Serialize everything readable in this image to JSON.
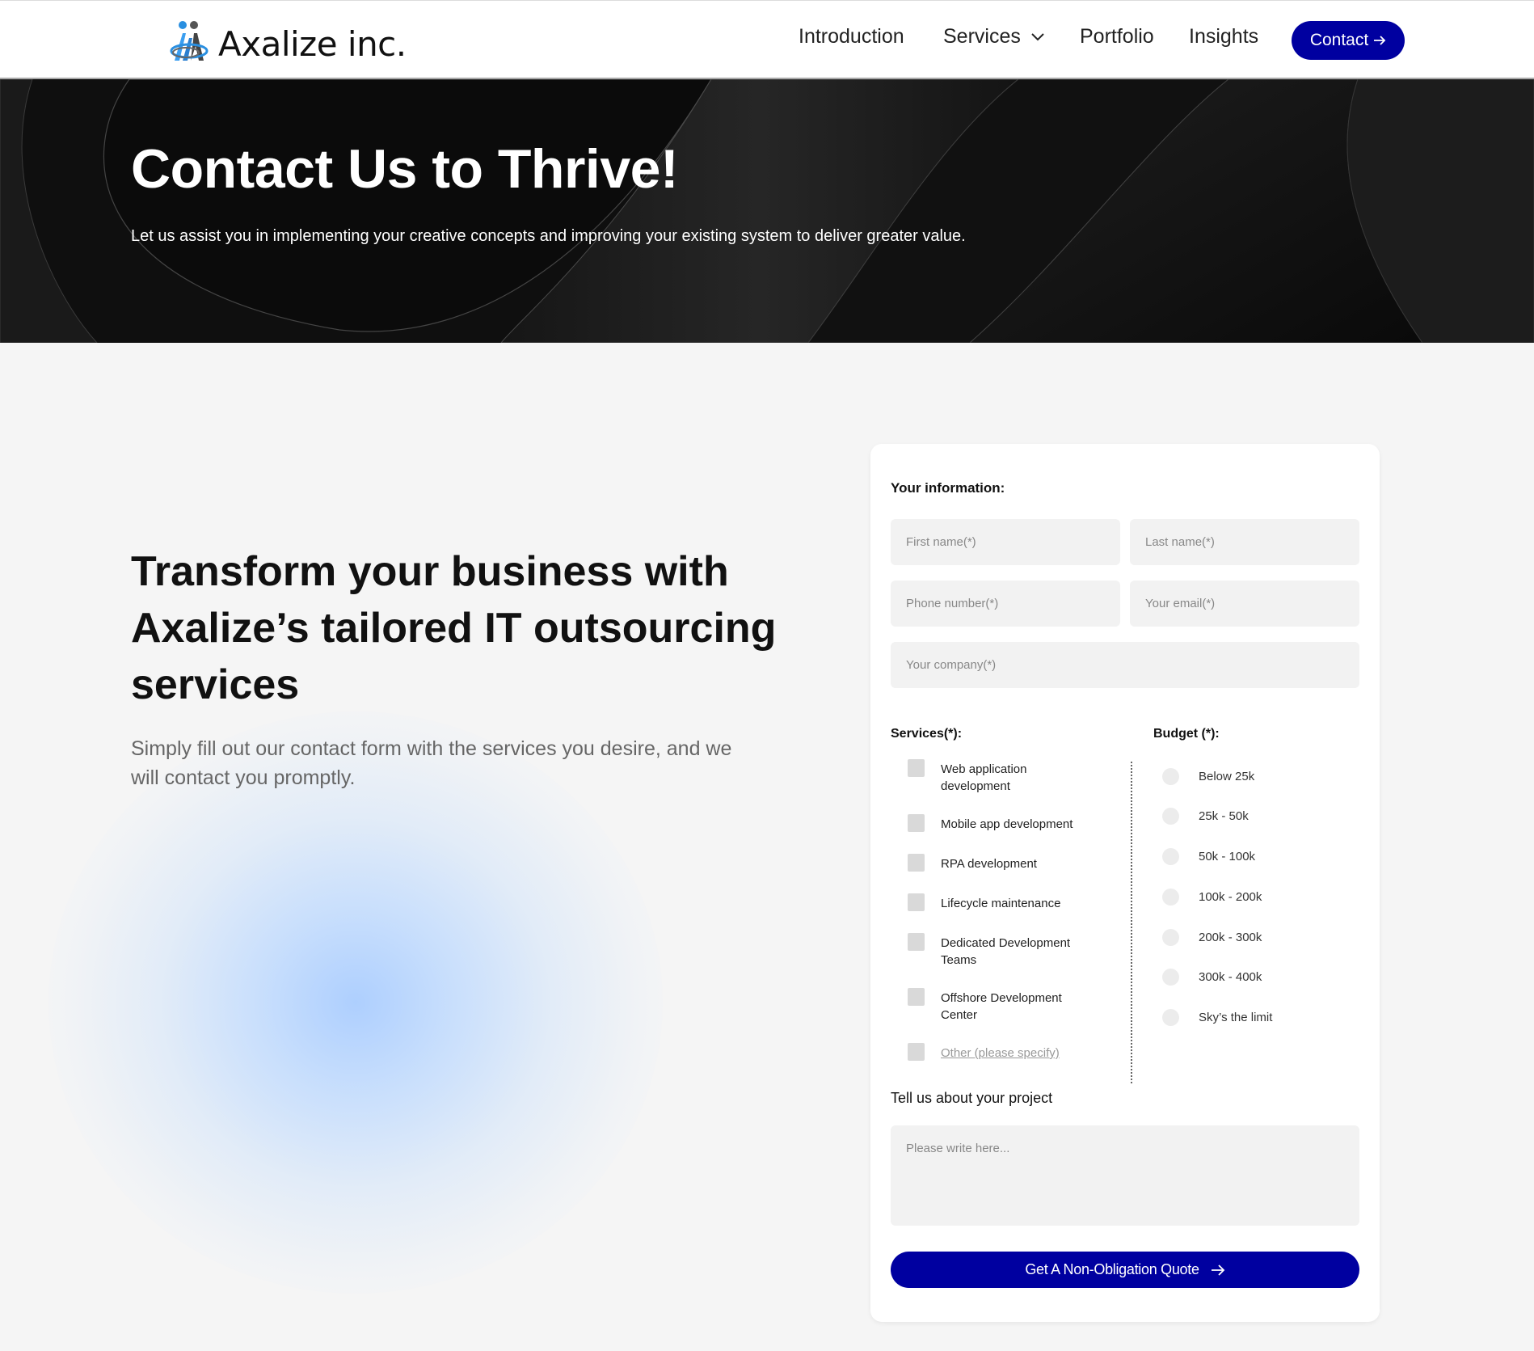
{
  "header": {
    "logo_text": "Axalize inc.",
    "nav": [
      {
        "label": "Introduction"
      },
      {
        "label": "Services",
        "has_dropdown": true
      },
      {
        "label": "Portfolio"
      },
      {
        "label": "Insights"
      }
    ],
    "contact_label": "Contact",
    "contact_icon": "arrow-right-icon",
    "accent_color": "#0000a0"
  },
  "hero": {
    "title": "Contact Us to Thrive!",
    "subtitle": "Let us assist you in implementing your creative concepts and improving your existing system to deliver greater value."
  },
  "intro": {
    "heading": "Transform your business with Axalize’s tailored IT outsourcing services",
    "subtext": "Simply fill out our contact form with the services you desire, and we will contact you promptly."
  },
  "form": {
    "info_label": "Your information:",
    "fields": {
      "first_name": {
        "placeholder": "First name(*)",
        "value": ""
      },
      "last_name": {
        "placeholder": "Last name(*)",
        "value": ""
      },
      "phone": {
        "placeholder": "Phone number(*)",
        "value": ""
      },
      "email": {
        "placeholder": "Your email(*)",
        "value": ""
      },
      "company": {
        "placeholder": "Your company(*)",
        "value": ""
      }
    },
    "services_label": "Services(*):",
    "services": [
      {
        "label": "Web application development",
        "checked": false
      },
      {
        "label": "Mobile app development",
        "checked": false
      },
      {
        "label": "RPA development",
        "checked": false
      },
      {
        "label": "Lifecycle maintenance",
        "checked": false
      },
      {
        "label": "Dedicated Development Teams",
        "checked": false
      },
      {
        "label": "Offshore Development Center",
        "checked": false
      },
      {
        "label": "Other (please specify)",
        "checked": false
      }
    ],
    "budget_label": "Budget (*):",
    "budgets": [
      {
        "label": "Below 25k",
        "selected": false
      },
      {
        "label": "25k - 50k",
        "selected": false
      },
      {
        "label": "50k - 100k",
        "selected": false
      },
      {
        "label": "100k - 200k",
        "selected": false
      },
      {
        "label": "200k - 300k",
        "selected": false
      },
      {
        "label": "300k - 400k",
        "selected": false
      },
      {
        "label": "Sky’s the limit",
        "selected": false
      }
    ],
    "project_label": "Tell us about your project",
    "project_placeholder": "Please write here...",
    "submit_label": "Get A Non-Obligation Quote",
    "submit_icon": "arrow-right-icon"
  }
}
